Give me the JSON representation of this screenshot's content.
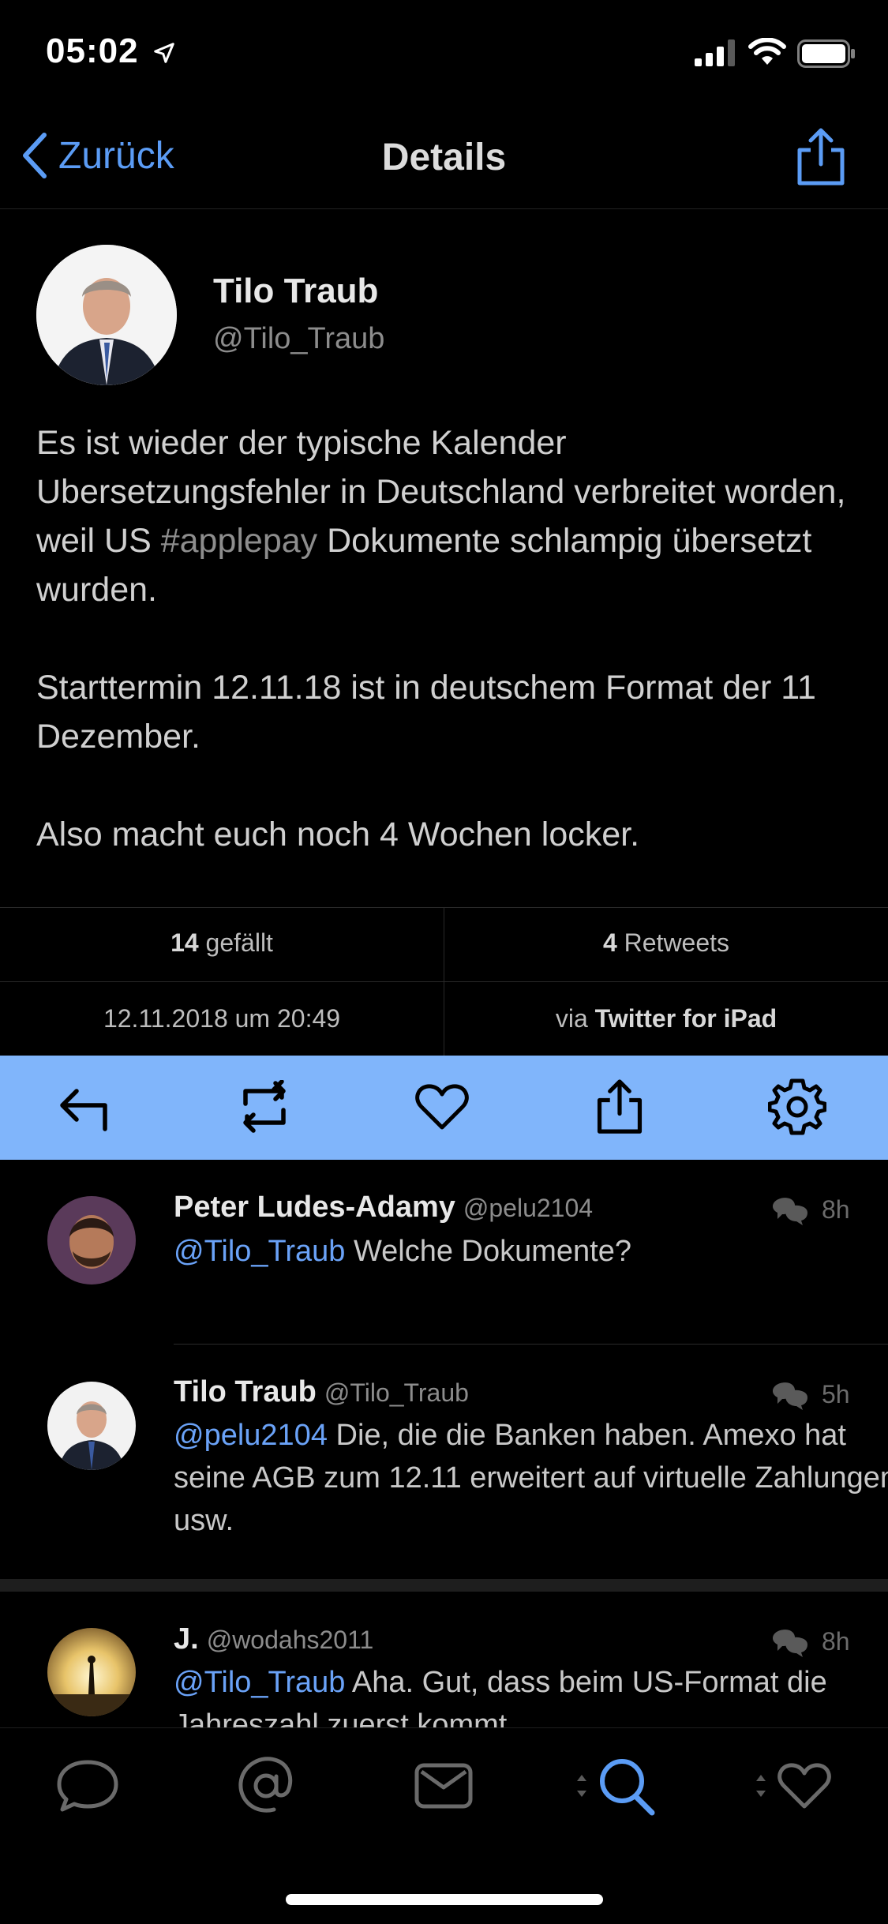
{
  "status_bar": {
    "time": "05:02"
  },
  "nav": {
    "back_label": "Zurück",
    "title": "Details"
  },
  "tweet": {
    "author_name": "Tilo Traub",
    "author_handle": "@Tilo_Traub",
    "text_p1_before": "Es ist wieder der typische Kalender Ubersetzungsfehler in Deutschland verbreitet worden, weil US ",
    "text_p1_hashtag": "#applepay",
    "text_p1_after": " Dokumente schlampig übersetzt wurden.",
    "text_p2": "Starttermin 12.11.18 ist in deutschem Format der 11 Dezember.",
    "text_p3": "Also macht euch noch 4 Wochen locker."
  },
  "stats": {
    "likes_count": "14",
    "likes_label": "gefällt",
    "retweets_count": "4",
    "retweets_label": "Retweets",
    "date": "12.11.2018 um 20:49",
    "via_label": "via",
    "client": "Twitter for iPad"
  },
  "replies": [
    {
      "name": "Peter Ludes-Adamy",
      "handle": "@pelu2104",
      "time": "8h",
      "mention": "@Tilo_Traub",
      "text": " Welche Dokumente?"
    },
    {
      "name": "Tilo Traub",
      "handle": "@Tilo_Traub",
      "time": "5h",
      "mention": "@pelu2104",
      "text": " Die, die die Banken haben. Amexo hat seine AGB zum 12.11 erweitert auf virtuelle Zahlungen usw."
    },
    {
      "name": "J.",
      "handle": "@wodahs2011",
      "time": "8h",
      "mention": "@Tilo_Traub",
      "text": " Aha. Gut, dass beim US-Format die Jahreszahl zuerst kommt."
    }
  ],
  "colors": {
    "accent": "#5b9cf5",
    "action_bar": "#80b5fb",
    "background": "#000000"
  },
  "icons": {
    "nav": [
      "chevron-left-icon",
      "share-icon"
    ],
    "actions": [
      "reply-icon",
      "retweet-icon",
      "heart-icon",
      "share-icon",
      "gear-icon"
    ],
    "tabs": [
      "chat-bubble-icon",
      "at-icon",
      "envelope-icon",
      "search-icon",
      "heart-icon"
    ]
  }
}
